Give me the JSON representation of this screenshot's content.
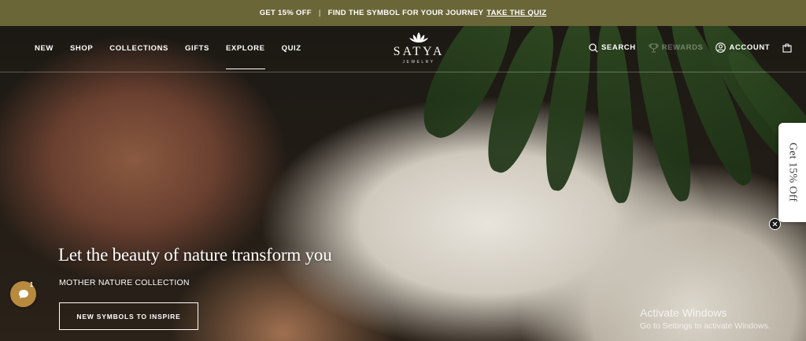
{
  "announcement": {
    "offer": "GET 15% OFF",
    "separator": "|",
    "message": "FIND THE SYMBOL FOR YOUR JOURNEY",
    "link": "TAKE THE QUIZ"
  },
  "nav": {
    "left": [
      "NEW",
      "SHOP",
      "COLLECTIONS",
      "GIFTS",
      "EXPLORE",
      "QUIZ"
    ],
    "active": "EXPLORE",
    "right": {
      "search": "SEARCH",
      "rewards": "REWARDS",
      "account": "ACCOUNT"
    }
  },
  "logo": {
    "name": "SATYA",
    "tagline": "JEWELRY"
  },
  "hero": {
    "headline": "Let the beauty of nature transform you",
    "subheadline": "MOTHER NATURE COLLECTION",
    "cta": "NEW SYMBOLS TO INSPIRE"
  },
  "side_tab": {
    "label": "Get 15% Off"
  },
  "chat": {
    "badge": "1"
  },
  "watermark": {
    "title": "Activate Windows",
    "subtitle": "Go to Settings to activate Windows."
  },
  "colors": {
    "announcement_bg": "#6b6638",
    "chat_bg": "#b88a3e"
  }
}
